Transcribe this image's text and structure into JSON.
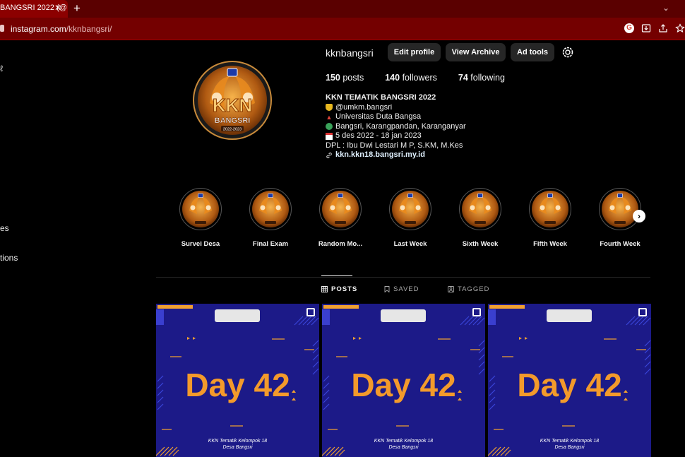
{
  "browser": {
    "tab_title": "BANGSRI 2022 (@",
    "close_glyph": "✕",
    "new_tab_glyph": "+",
    "tab_menu_glyph": "⌄",
    "url_host": "instagram.com",
    "url_path": "/kknbangsri/"
  },
  "nav": {
    "frag1": "ℓ",
    "frag2": "es",
    "frag3": "tions"
  },
  "profile": {
    "username": "kknbangsri",
    "edit_profile": "Edit profile",
    "view_archive": "View Archive",
    "ad_tools": "Ad tools",
    "posts_count": "150",
    "posts_label": "posts",
    "followers_count": "140",
    "followers_label": "followers",
    "following_count": "74",
    "following_label": "following",
    "logo_text": "KKN",
    "logo_sub": "BANGSRI",
    "logo_year": "2022-2023"
  },
  "bio": {
    "name": "KKN TEMATIK BANGSRI 2022",
    "line1": "@umkm.bangsri",
    "line2": "Universitas Duta Bangsa",
    "line3": "Bangsri, Karangpandan, Karanganyar",
    "line4": "5 des 2022 - 18 jan 2023",
    "line5": "DPL : Ibu Dwi Lestari M P, S.KM, M.Kes",
    "link": "kkn.kkn18.bangsri.my.id"
  },
  "highlights": [
    {
      "label": "Survei Desa"
    },
    {
      "label": "Final Exam"
    },
    {
      "label": "Random Mo..."
    },
    {
      "label": "Last Week"
    },
    {
      "label": "Sixth Week"
    },
    {
      "label": "Fifth Week"
    },
    {
      "label": "Fourth Week"
    }
  ],
  "tabs": {
    "posts": "POSTS",
    "saved": "SAVED",
    "tagged": "TAGGED"
  },
  "posts": [
    {
      "title": "Day 42",
      "caption1": "KKN Tematik Kelompok 18",
      "caption2": "Desa Bangsri"
    },
    {
      "title": "Day 42",
      "caption1": "KKN Tematik Kelompok 18",
      "caption2": "Desa Bangsri"
    },
    {
      "title": "Day 42",
      "caption1": "KKN Tematik Kelompok 18",
      "caption2": "Desa Bangsri"
    }
  ],
  "colors": {
    "accent_orange": "#f39a2b",
    "post_blue": "#1c1a88",
    "browser_red": "#740000"
  }
}
